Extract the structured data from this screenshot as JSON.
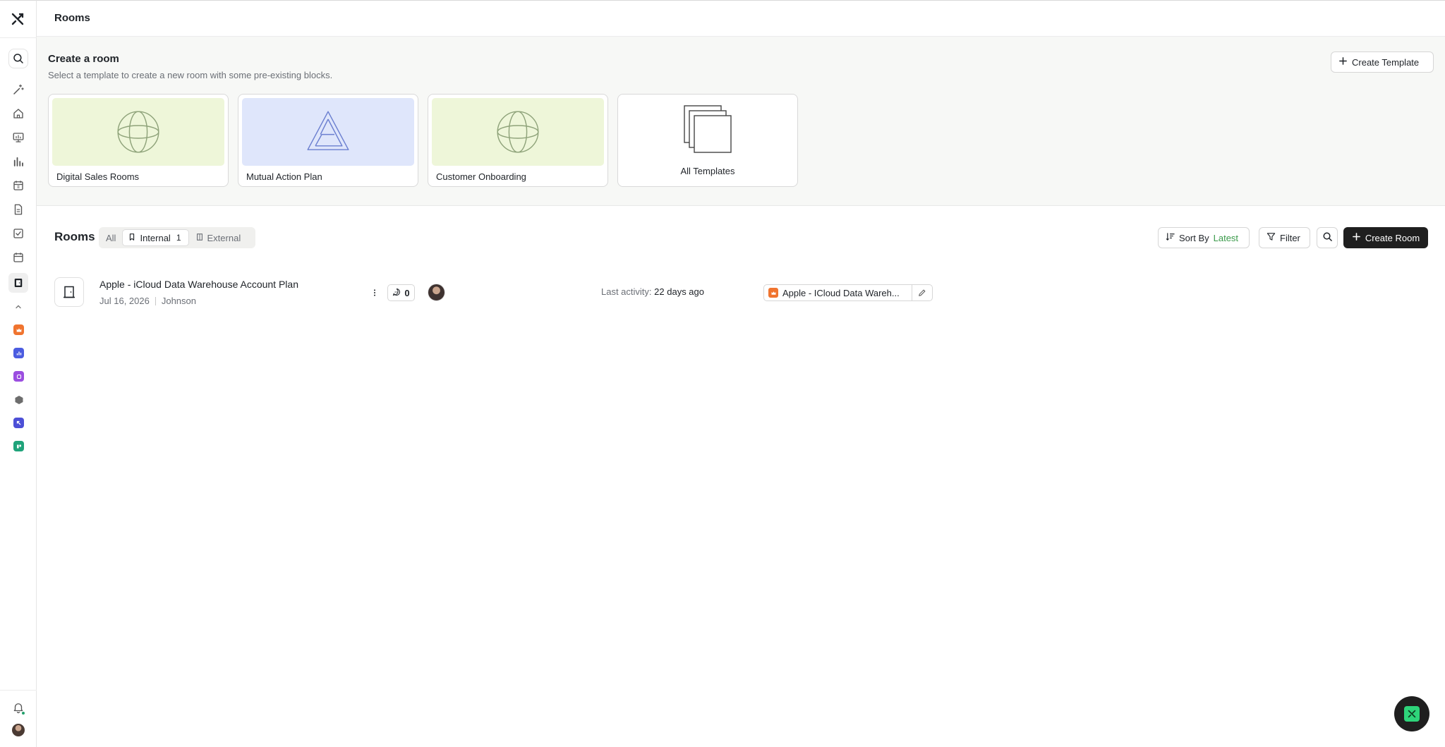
{
  "header": {
    "title": "Rooms"
  },
  "create_panel": {
    "title": "Create a room",
    "subtitle": "Select a template to create a new room with some pre-existing blocks.",
    "create_template_label": "Create Template",
    "templates": [
      {
        "label": "Digital Sales Rooms",
        "art_color": "#eef6d9"
      },
      {
        "label": "Mutual Action Plan",
        "art_color": "#dfe6fb"
      },
      {
        "label": "Customer Onboarding",
        "art_color": "#eef6d9"
      },
      {
        "label": "All Templates"
      }
    ]
  },
  "rooms": {
    "title": "Rooms",
    "tabs": [
      {
        "label": "All"
      },
      {
        "label": "Internal",
        "count": "1",
        "active": true
      },
      {
        "label": "External"
      }
    ],
    "sort": {
      "prefix": "Sort By",
      "value": "Latest"
    },
    "filter_label": "Filter",
    "create_room_label": "Create Room",
    "list": [
      {
        "name": "Apple - iCloud Data Warehouse Account Plan",
        "date": "Jul 16, 2026",
        "owner": "Johnson",
        "comments": "0",
        "last_activity_label": "Last activity:",
        "last_activity_value": "22 days ago",
        "account_tag": "Apple - ICloud Data Wareh..."
      }
    ]
  },
  "colors": {
    "accent_green": "#3a9a4a",
    "dark_button": "#1f1f1f",
    "brand_green": "#2ed47a"
  }
}
